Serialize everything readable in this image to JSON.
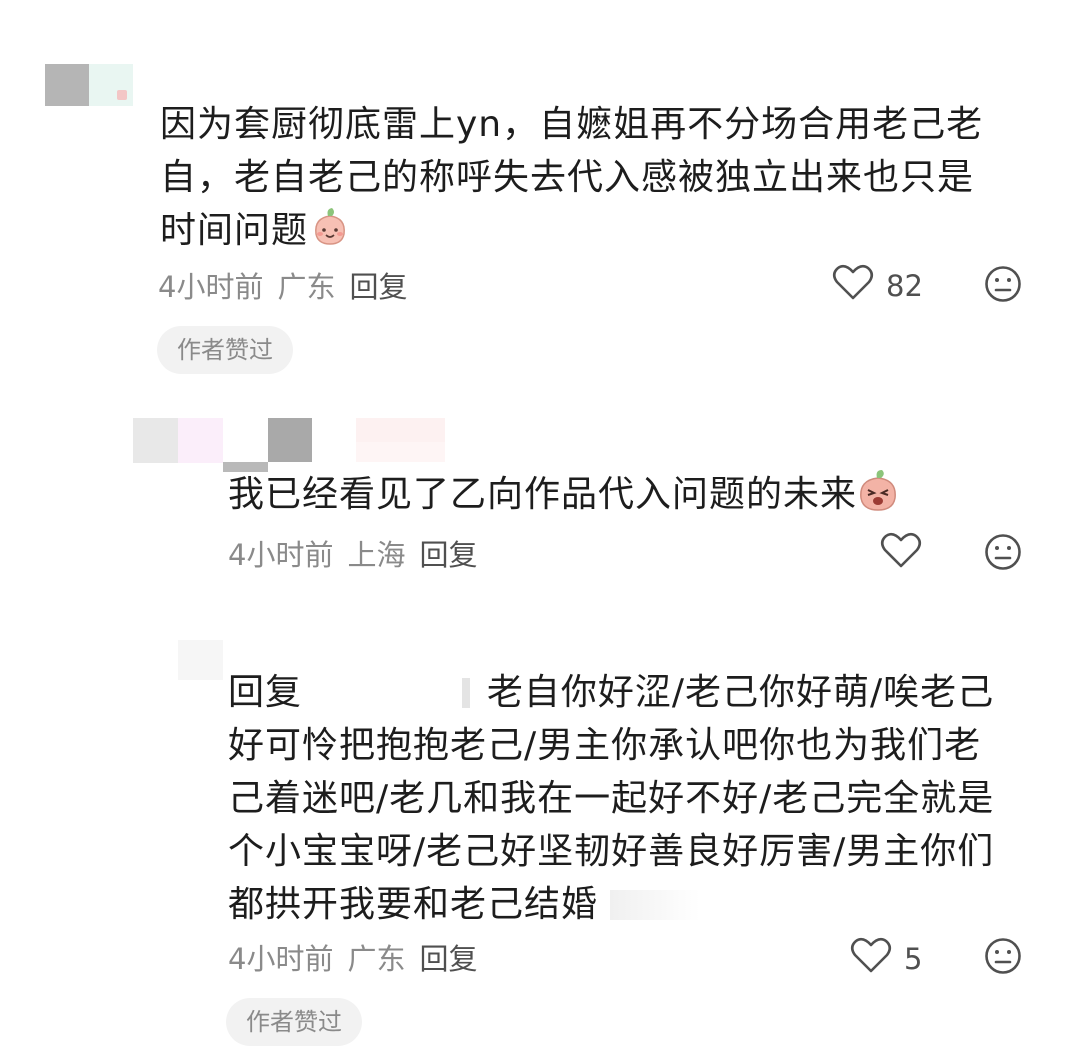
{
  "comments": [
    {
      "text": "因为套厨彻底雷上yn，自嬷姐再不分场合用老己老自，老自老己的称呼失去代入感被独立出来也只是时间问题",
      "text_lines": [
        "因为套厨彻底雷上yn，自嬷姐再不分场合用老己老",
        "自，老自老己的称呼失去代入感被独立出来也只是",
        "时间问题"
      ],
      "time": "4小时前",
      "location": "广东",
      "reply_label": "回复",
      "likes": "82",
      "badge": "作者赞过",
      "emoji": "smiling-peach-emoji"
    },
    {
      "text": "我已经看见了乙向作品代入问题的未来",
      "time": "4小时前",
      "location": "上海",
      "reply_label": "回复",
      "likes": "",
      "emoji": "crying-peach-emoji"
    },
    {
      "reply_prefix": "回复",
      "text_lines": [
        "老自你好涩/老己你好萌/唉老己",
        "好可怜把抱抱老己/男主你承认吧你也为我们老",
        "己着迷吧/老几和我在一起好不好/老己完全就是",
        "个小宝宝呀/老己好坚韧好善良好厉害/男主你们",
        "都拱开我要和老己结婚"
      ],
      "time": "4小时前",
      "location": "广东",
      "reply_label": "回复",
      "likes": "5",
      "badge": "作者赞过"
    }
  ],
  "colors": {
    "text": "#1d1d1d",
    "meta": "#8a8a8a",
    "badge_bg": "#f2f2f2"
  },
  "icons": [
    "heart-outline-icon",
    "neutral-face-icon"
  ]
}
